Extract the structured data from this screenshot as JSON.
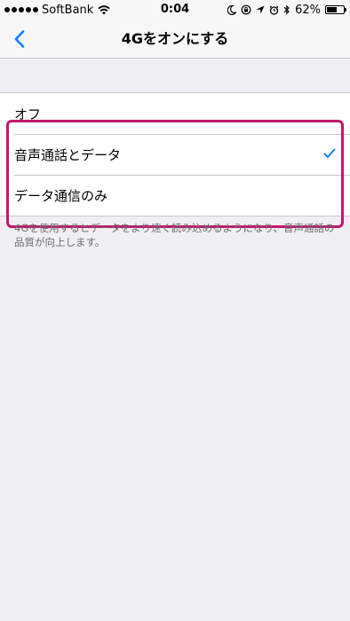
{
  "status_bar": {
    "carrier": "SoftBank",
    "time": "0:04",
    "battery_percent": "62%",
    "battery_level": 0.62,
    "icons": [
      "signal-dots",
      "wifi-icon",
      "moon-icon",
      "rotation-lock-icon",
      "location-icon",
      "alarm-icon",
      "bluetooth-icon",
      "battery-icon"
    ]
  },
  "nav": {
    "title": "4Gをオンにする",
    "back_icon": "chevron-left-icon"
  },
  "options": [
    {
      "label": "オフ",
      "selected": false
    },
    {
      "label": "音声通話とデータ",
      "selected": true
    },
    {
      "label": "データ通信のみ",
      "selected": false
    }
  ],
  "footer": "4Gを使用するとデータをより速く読み込めるようになり、音声通話の品質が向上します。",
  "colors": {
    "accent": "#157efb",
    "highlight": "#c2186b",
    "background": "#efeff4"
  }
}
